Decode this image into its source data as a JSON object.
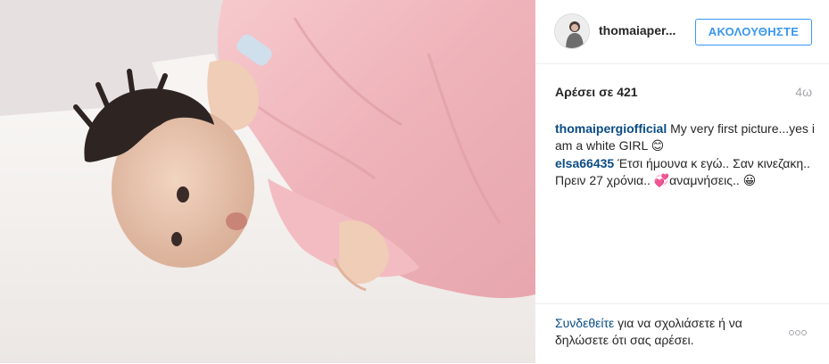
{
  "post": {
    "username": "thomaiaper...",
    "follow_label": "ΑΚΟΛΟΥΘΗΣΤΕ",
    "likes": "Αρέσει σε 421",
    "age": "4ω"
  },
  "comments": [
    {
      "user": "thomaipergiofficial",
      "text": " My very first picture...yes i am a white GIRL 😊"
    },
    {
      "user": "elsa66435",
      "text": " Έτσι ήμουνα κ εγώ.. Σαν κινεζακη.. Πρειν 27 χρόνια.. 💞αναμνήσεις.. 😀"
    }
  ],
  "footer": {
    "login_link": "Συνδεθείτε",
    "login_text": " για να σχολιάσετε ή να δηλώσετε ότι σας αρέσει."
  },
  "icons": {
    "more": "more-options-icon"
  },
  "colors": {
    "accent": "#3897f0",
    "link": "#0a4b84",
    "muted": "#a5a7aa"
  }
}
